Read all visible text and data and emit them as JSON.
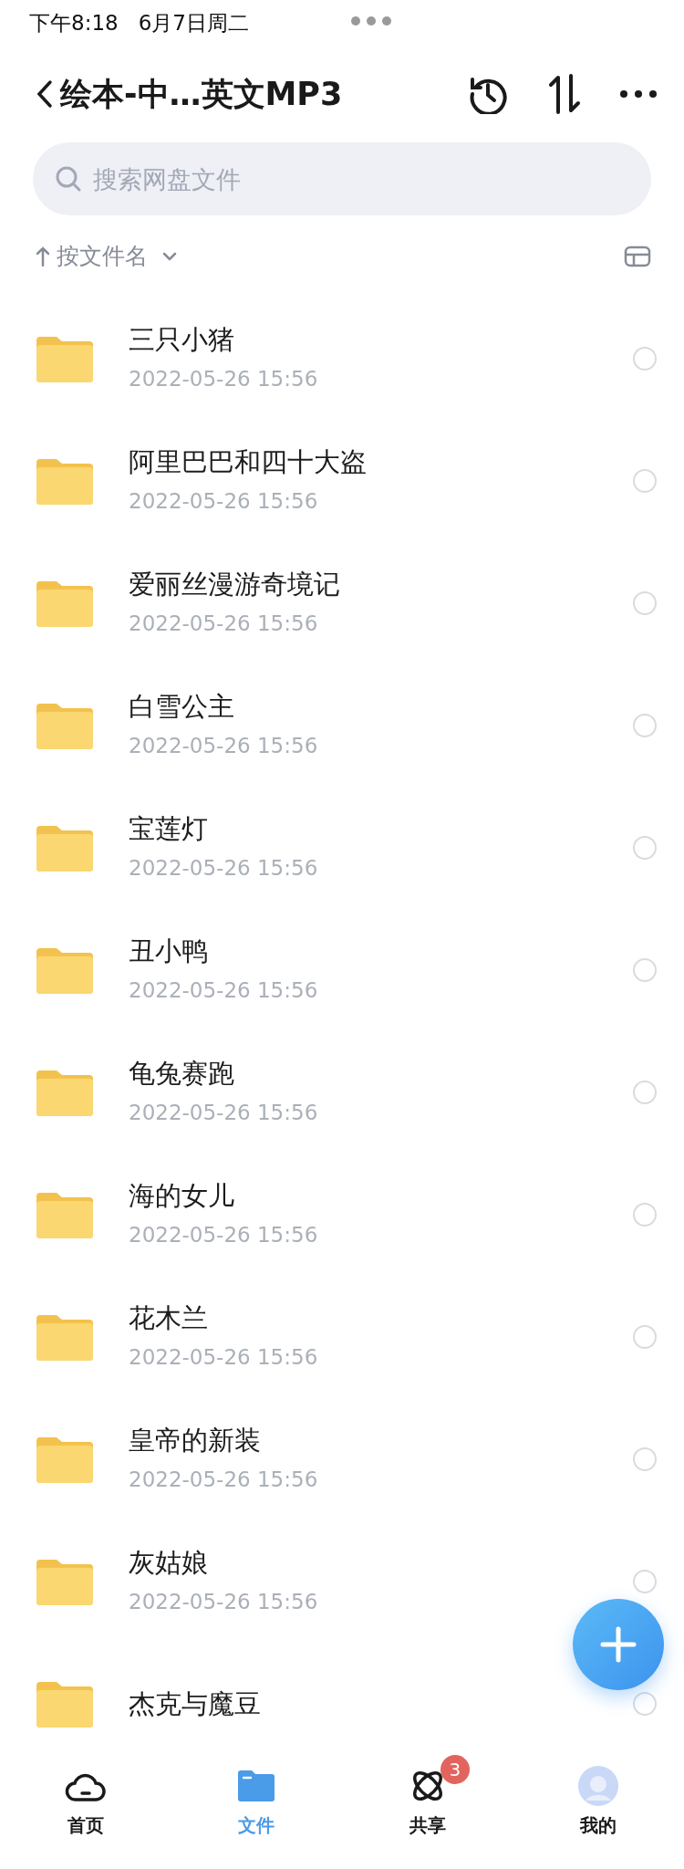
{
  "status_bar": {
    "time": "下午8:18",
    "date": "6月7日周二"
  },
  "header": {
    "title": "绘本-中…英文MP3"
  },
  "search": {
    "placeholder": "搜索网盘文件"
  },
  "sort": {
    "label": "按文件名"
  },
  "files": [
    {
      "name": "三只小猪",
      "date": "2022-05-26 15:56",
      "selected": false
    },
    {
      "name": "阿里巴巴和四十大盗",
      "date": "2022-05-26 15:56",
      "selected": false
    },
    {
      "name": "爱丽丝漫游奇境记",
      "date": "2022-05-26 15:56",
      "selected": false
    },
    {
      "name": "白雪公主",
      "date": "2022-05-26 15:56",
      "selected": false
    },
    {
      "name": "宝莲灯",
      "date": "2022-05-26 15:56",
      "selected": false
    },
    {
      "name": "丑小鸭",
      "date": "2022-05-26 15:56",
      "selected": false
    },
    {
      "name": "龟兔赛跑",
      "date": "2022-05-26 15:56",
      "selected": false
    },
    {
      "name": "海的女儿",
      "date": "2022-05-26 15:56",
      "selected": false
    },
    {
      "name": "花木兰",
      "date": "2022-05-26 15:56",
      "selected": false
    },
    {
      "name": "皇帝的新装",
      "date": "2022-05-26 15:56",
      "selected": false
    },
    {
      "name": "灰姑娘",
      "date": "2022-05-26 15:56",
      "selected": false
    },
    {
      "name": "杰克与魔豆",
      "selected": false
    }
  ],
  "tabs": [
    {
      "label": "首页",
      "kind": "home",
      "selected": false
    },
    {
      "label": "文件",
      "kind": "files",
      "selected": true
    },
    {
      "label": "共享",
      "kind": "share",
      "selected": false,
      "badge": "3"
    },
    {
      "label": "我的",
      "kind": "me",
      "selected": false
    }
  ]
}
